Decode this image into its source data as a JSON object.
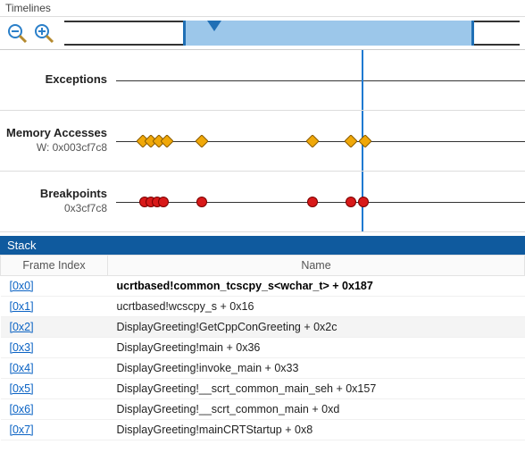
{
  "timelines": {
    "section_title": "Timelines",
    "zoom_out_icon": "zoom-out",
    "zoom_in_icon": "zoom-in",
    "overview": {
      "range_start_pct": 26,
      "range_end_pct": 90,
      "marker_pct": 33
    },
    "cursor_pct": 60,
    "rows": [
      {
        "title": "Exceptions",
        "sub": "",
        "events": []
      },
      {
        "title": "Memory Accesses",
        "sub": "W: 0x003cf7c8",
        "shape": "diamond",
        "color": "#f0a808",
        "events_pct": [
          6.5,
          8.5,
          10.5,
          12.5,
          21,
          48,
          57.5,
          61
        ]
      },
      {
        "title": "Breakpoints",
        "sub": "0x3cf7c8",
        "shape": "circle",
        "color": "#d81919",
        "events_pct": [
          7,
          8.5,
          10,
          11.5,
          21,
          48,
          57.5,
          60.5
        ]
      }
    ]
  },
  "stack": {
    "section_title": "Stack",
    "columns": {
      "frame": "Frame Index",
      "name": "Name"
    },
    "frames": [
      {
        "index": "[0x0]",
        "name": "ucrtbased!common_tcscpy_s<wchar_t> + 0x187",
        "bold": true
      },
      {
        "index": "[0x1]",
        "name": "ucrtbased!wcscpy_s + 0x16"
      },
      {
        "index": "[0x2]",
        "name": "DisplayGreeting!GetCppConGreeting + 0x2c",
        "hover": true
      },
      {
        "index": "[0x3]",
        "name": "DisplayGreeting!main + 0x36"
      },
      {
        "index": "[0x4]",
        "name": "DisplayGreeting!invoke_main + 0x33"
      },
      {
        "index": "[0x5]",
        "name": "DisplayGreeting!__scrt_common_main_seh + 0x157"
      },
      {
        "index": "[0x6]",
        "name": "DisplayGreeting!__scrt_common_main + 0xd"
      },
      {
        "index": "[0x7]",
        "name": "DisplayGreeting!mainCRTStartup + 0x8"
      }
    ]
  }
}
